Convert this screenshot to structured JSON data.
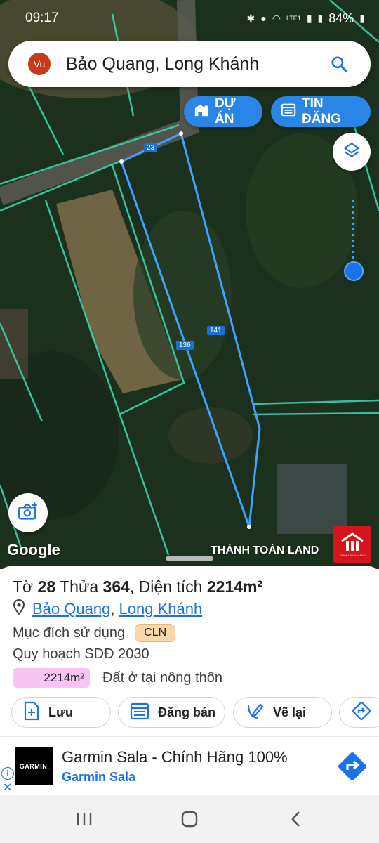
{
  "status": {
    "time": "09:17",
    "battery": "84%",
    "network": "LTE1"
  },
  "search": {
    "avatar_initials": "Vu",
    "query": "Bảo Quang, Long Khánh",
    "icon": "search-icon"
  },
  "chips": {
    "du_an": "DỰ ÁN",
    "tin_dang": "TIN ĐĂNG"
  },
  "map": {
    "lot_labels": [
      "23",
      "141",
      "136"
    ],
    "watermark": "Google",
    "brand_text": "THÀNH TOÀN LAND",
    "brand_logo_sub": "THANH TOAN LAND"
  },
  "parcel": {
    "sheet_prefix": "Tờ",
    "sheet": "28",
    "lot_prefix": "Thửa",
    "lot": "364",
    "area_prefix": ", Diện tích",
    "area": "2214m²",
    "ward": "Bảo Quang",
    "city": "Long Khánh",
    "purpose_label": "Mục đích sử dụng",
    "purpose_code": "CLN",
    "plan_label": "Quy hoạch SDĐ 2030",
    "plan_area": "2214m²",
    "plan_type": "Đất ở tại nông thôn"
  },
  "actions": {
    "save": "Lưu",
    "sell": "Đăng bán",
    "redraw": "Vẽ lại"
  },
  "ad": {
    "brand": "GARMIN.",
    "title": "Garmin Sala - Chính Hãng 100%",
    "subtitle": "Garmin Sala",
    "info": "i",
    "close": "✕"
  },
  "colors": {
    "accent": "#2a86e6",
    "parcel": "#3ea3ff",
    "boundary": "#3cd0b0",
    "brand_red": "#d6141c"
  }
}
